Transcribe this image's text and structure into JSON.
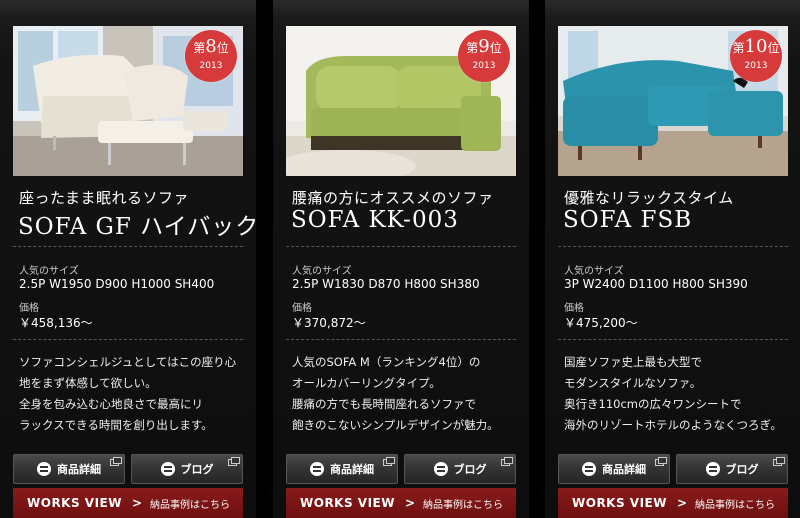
{
  "colors": {
    "rank_badge": "#d63a3a",
    "works_bar": "#7a1414",
    "card_bg": "#141414"
  },
  "cards": [
    {
      "rank_prefix": "第",
      "rank_number": "8",
      "rank_suffix": "位",
      "rank_year": "2013",
      "photo_icon": "white-leather-sofa-photo",
      "subtitle": "座ったまま眠れるソファ",
      "title": "SOFA GF ハイバック",
      "size_label": "人気のサイズ",
      "size_value": "2.5P W1950 D900 H1000 SH400",
      "price_label": "価格",
      "price_value": "￥458,136〜",
      "desc": [
        "ソファコンシェルジュとしてはこの座り心",
        "地をまず体感して欲しい。",
        "全身を包み込む心地良さで最高にリ",
        "ラックスできる時間を創り出します。"
      ],
      "btn_detail": "商品詳細",
      "btn_blog": "ブログ",
      "works_label": "WORKS VIEW",
      "works_arrow": ">",
      "works_sub": "納品事例はこちら"
    },
    {
      "rank_prefix": "第",
      "rank_number": "9",
      "rank_suffix": "位",
      "rank_year": "2013",
      "photo_icon": "green-fabric-sofa-photo",
      "subtitle": "腰痛の方にオススメのソファ",
      "title": "SOFA KK-003",
      "size_label": "人気のサイズ",
      "size_value": "2.5P W1830 D870 H800 SH380",
      "price_label": "価格",
      "price_value": "￥370,872〜",
      "desc": [
        "人気のSOFA M（ランキング4位）の",
        "オールカバーリングタイプ。",
        "腰痛の方でも長時間座れるソファで",
        "飽きのこないシンプルデザインが魅力。"
      ],
      "btn_detail": "商品詳細",
      "btn_blog": "ブログ",
      "works_label": "WORKS VIEW",
      "works_arrow": ">",
      "works_sub": "納品事例はこちら"
    },
    {
      "rank_prefix": "第",
      "rank_number": "10",
      "rank_suffix": "位",
      "rank_year": "2013",
      "photo_icon": "teal-corner-sofa-photo",
      "subtitle": "優雅なリラックスタイム",
      "title": "SOFA FSB",
      "size_label": "人気のサイズ",
      "size_value": "3P W2400 D1100 H800 SH390",
      "price_label": "価格",
      "price_value": "￥475,200〜",
      "desc": [
        "国産ソファ史上最も大型で",
        "モダンスタイルなソファ。",
        "奥行き110cmの広々ワンシートで",
        "海外のリゾートホテルのようなくつろぎ。"
      ],
      "btn_detail": "商品詳細",
      "btn_blog": "ブログ",
      "works_label": "WORKS VIEW",
      "works_arrow": ">",
      "works_sub": "納品事例はこちら"
    }
  ]
}
